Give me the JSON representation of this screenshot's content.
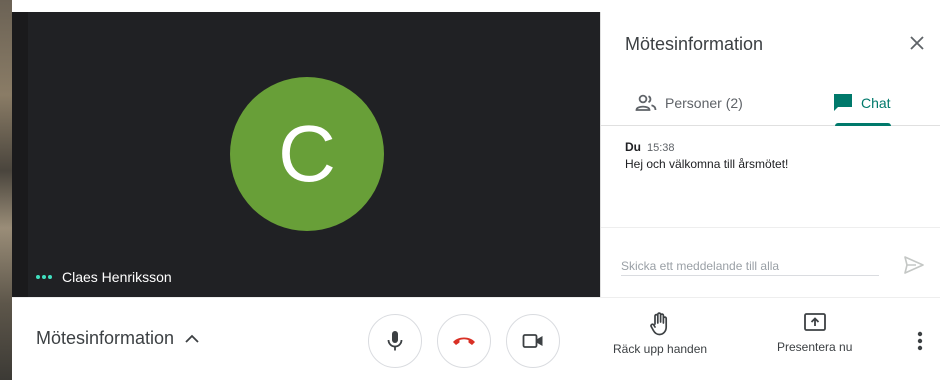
{
  "video": {
    "avatar_letter": "C",
    "avatar_color": "#689f38",
    "participant_name": "Claes Henriksson"
  },
  "panel": {
    "title": "Mötesinformation",
    "tabs": [
      {
        "label": "Personer (2)",
        "icon": "people-icon"
      },
      {
        "label": "Chat",
        "icon": "chat-icon",
        "active": true
      }
    ],
    "messages": [
      {
        "sender": "Du",
        "time": "15:38",
        "text": "Hej och välkomna till årsmötet!"
      }
    ],
    "compose_placeholder": "Skicka ett meddelande till alla"
  },
  "bottom": {
    "meeting_info_label": "Mötesinformation",
    "raise_hand_label": "Räck upp handen",
    "present_label": "Presentera nu",
    "hangup_color": "#d93025"
  },
  "colors": {
    "accent": "#00796b",
    "video_bg": "#202124"
  }
}
